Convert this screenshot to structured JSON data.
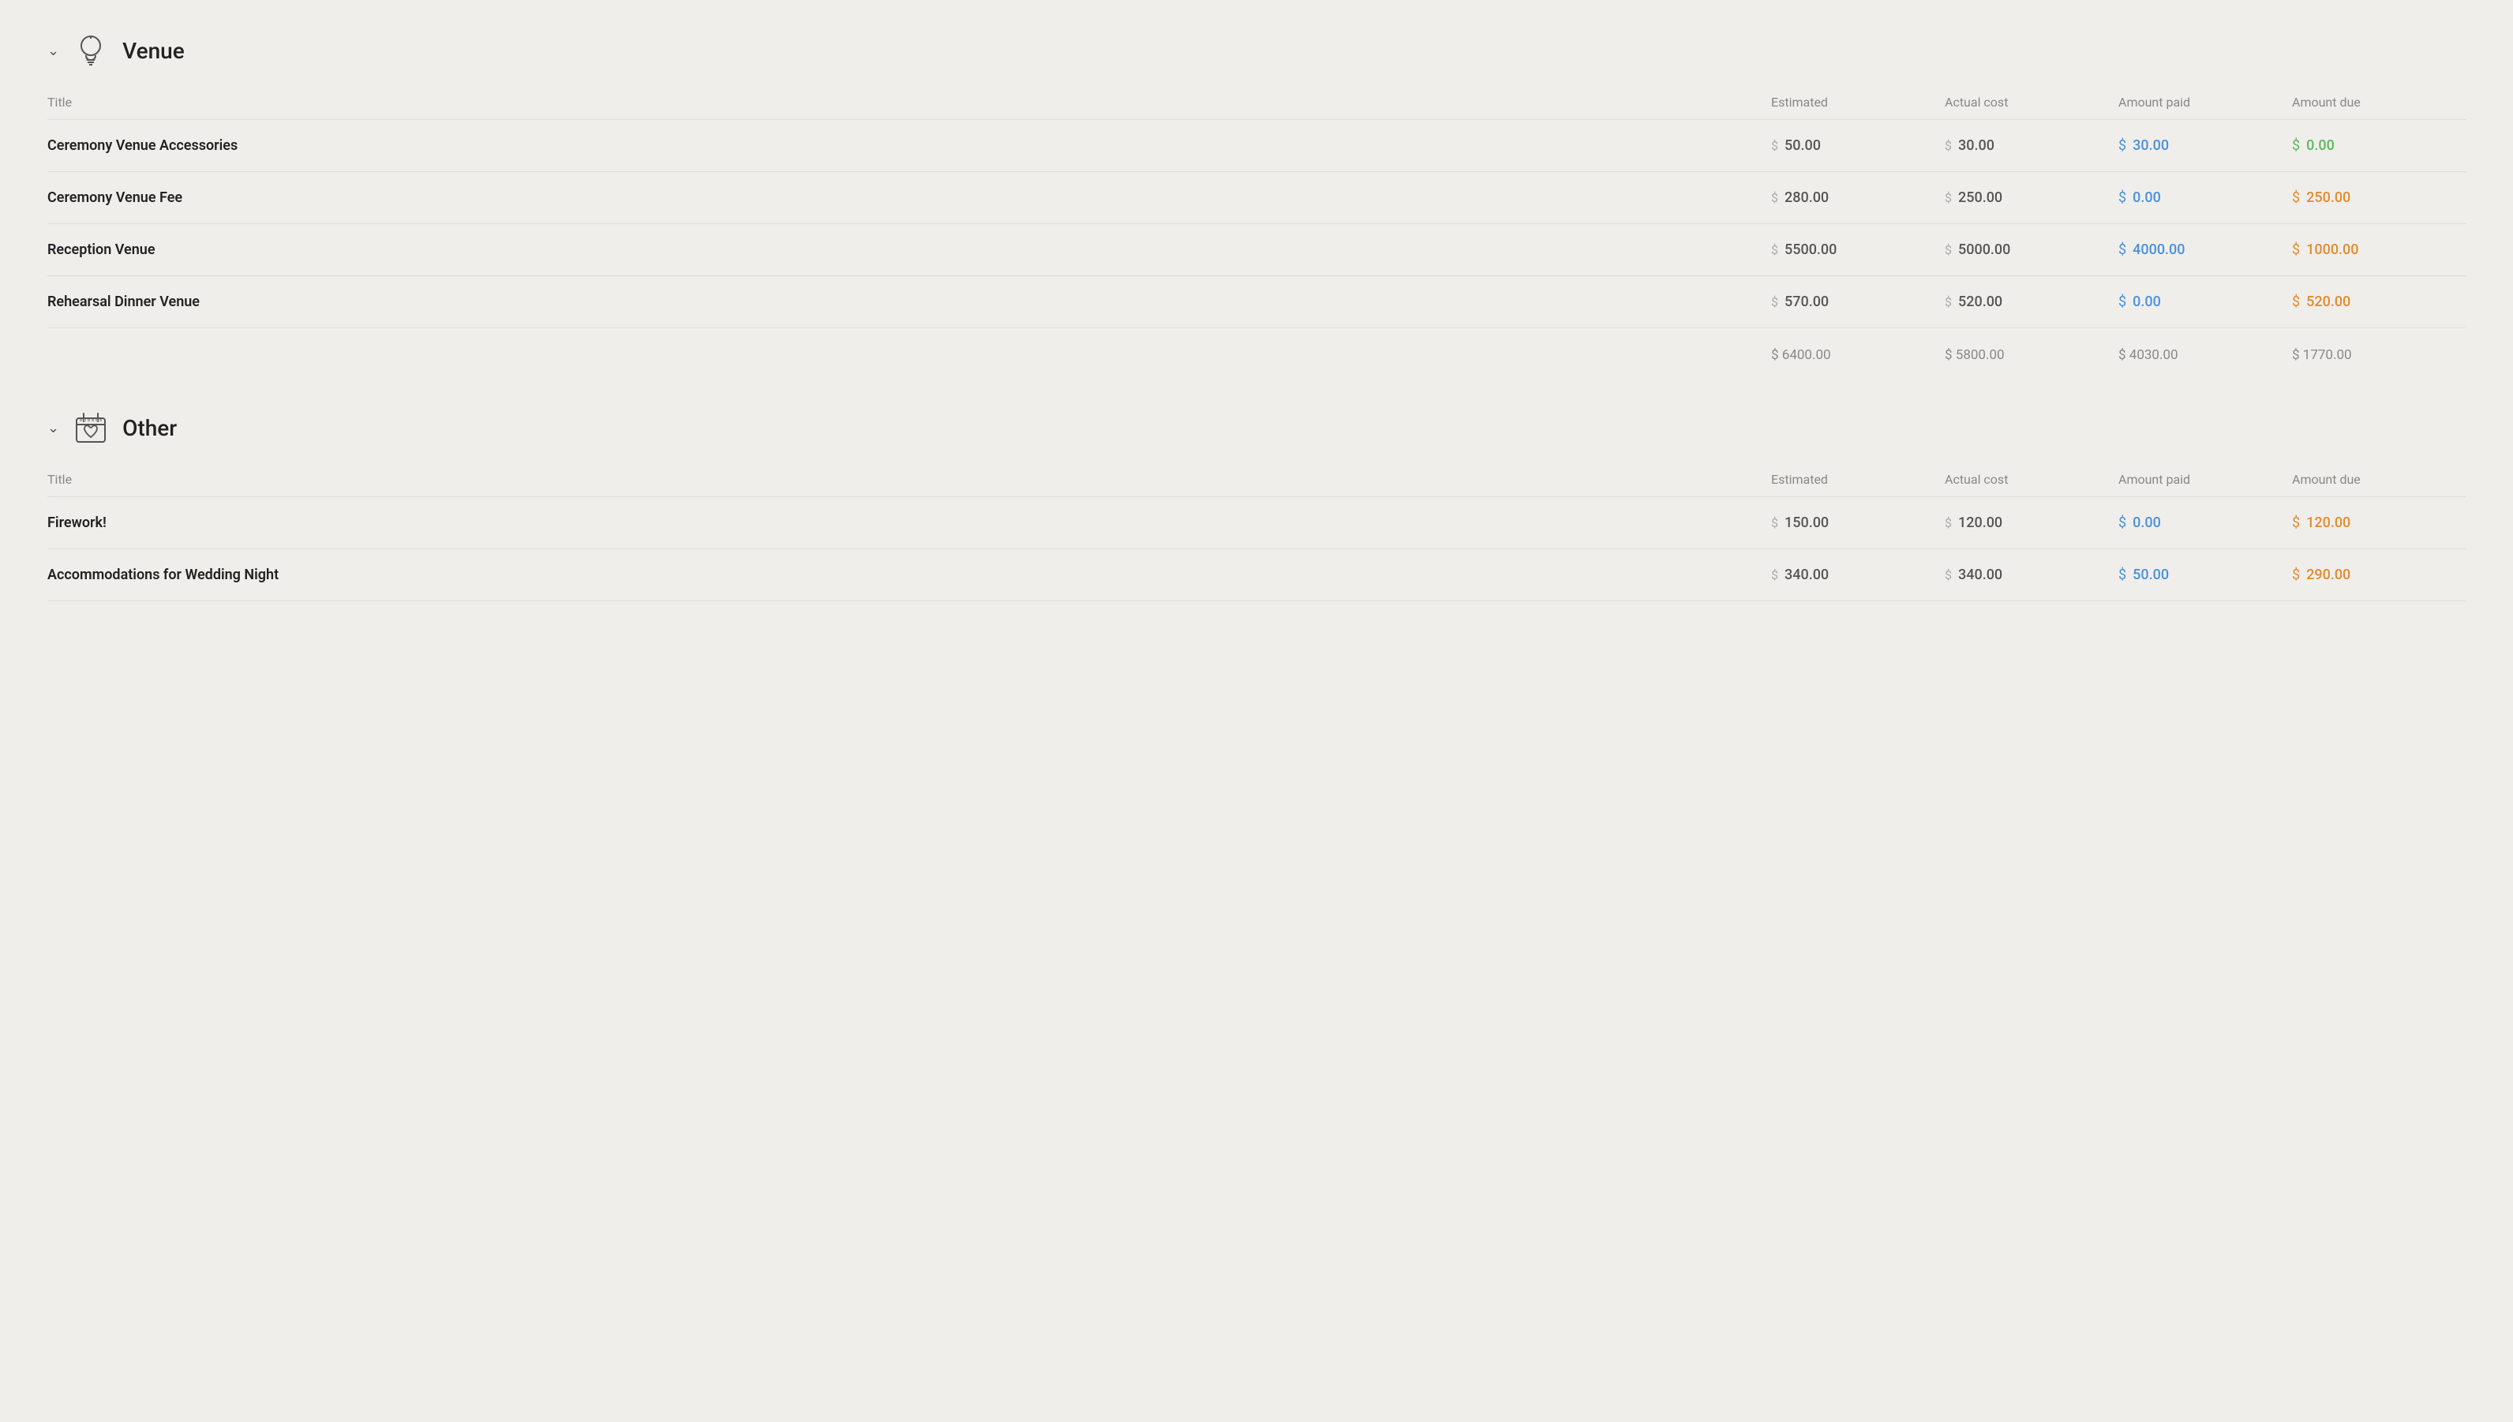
{
  "venue_section": {
    "title": "Venue",
    "chevron": "chevron-down",
    "columns": {
      "title": "Title",
      "estimated": "Estimated",
      "actual_cost": "Actual cost",
      "amount_paid": "Amount paid",
      "amount_due": "Amount due"
    },
    "rows": [
      {
        "title": "Ceremony Venue Accessories",
        "estimated": "50.00",
        "actual_cost": "30.00",
        "amount_paid": "30.00",
        "amount_paid_color": "blue",
        "amount_due": "0.00",
        "amount_due_color": "green"
      },
      {
        "title": "Ceremony Venue Fee",
        "estimated": "280.00",
        "actual_cost": "250.00",
        "amount_paid": "0.00",
        "amount_paid_color": "blue",
        "amount_due": "250.00",
        "amount_due_color": "orange"
      },
      {
        "title": "Reception Venue",
        "estimated": "5500.00",
        "actual_cost": "5000.00",
        "amount_paid": "4000.00",
        "amount_paid_color": "blue",
        "amount_due": "1000.00",
        "amount_due_color": "orange"
      },
      {
        "title": "Rehearsal Dinner Venue",
        "estimated": "570.00",
        "actual_cost": "520.00",
        "amount_paid": "0.00",
        "amount_paid_color": "blue",
        "amount_due": "520.00",
        "amount_due_color": "orange"
      }
    ],
    "totals": {
      "estimated": "$ 6400.00",
      "actual_cost": "$ 5800.00",
      "amount_paid": "$ 4030.00",
      "amount_due": "$ 1770.00"
    }
  },
  "other_section": {
    "title": "Other",
    "chevron": "chevron-down",
    "columns": {
      "title": "Title",
      "estimated": "Estimated",
      "actual_cost": "Actual cost",
      "amount_paid": "Amount paid",
      "amount_due": "Amount due"
    },
    "rows": [
      {
        "title": "Firework!",
        "estimated": "150.00",
        "actual_cost": "120.00",
        "amount_paid": "0.00",
        "amount_paid_color": "blue",
        "amount_due": "120.00",
        "amount_due_color": "orange"
      },
      {
        "title": "Accommodations for Wedding Night",
        "estimated": "340.00",
        "actual_cost": "340.00",
        "amount_paid": "50.00",
        "amount_paid_color": "blue",
        "amount_due": "290.00",
        "amount_due_color": "orange"
      }
    ]
  }
}
